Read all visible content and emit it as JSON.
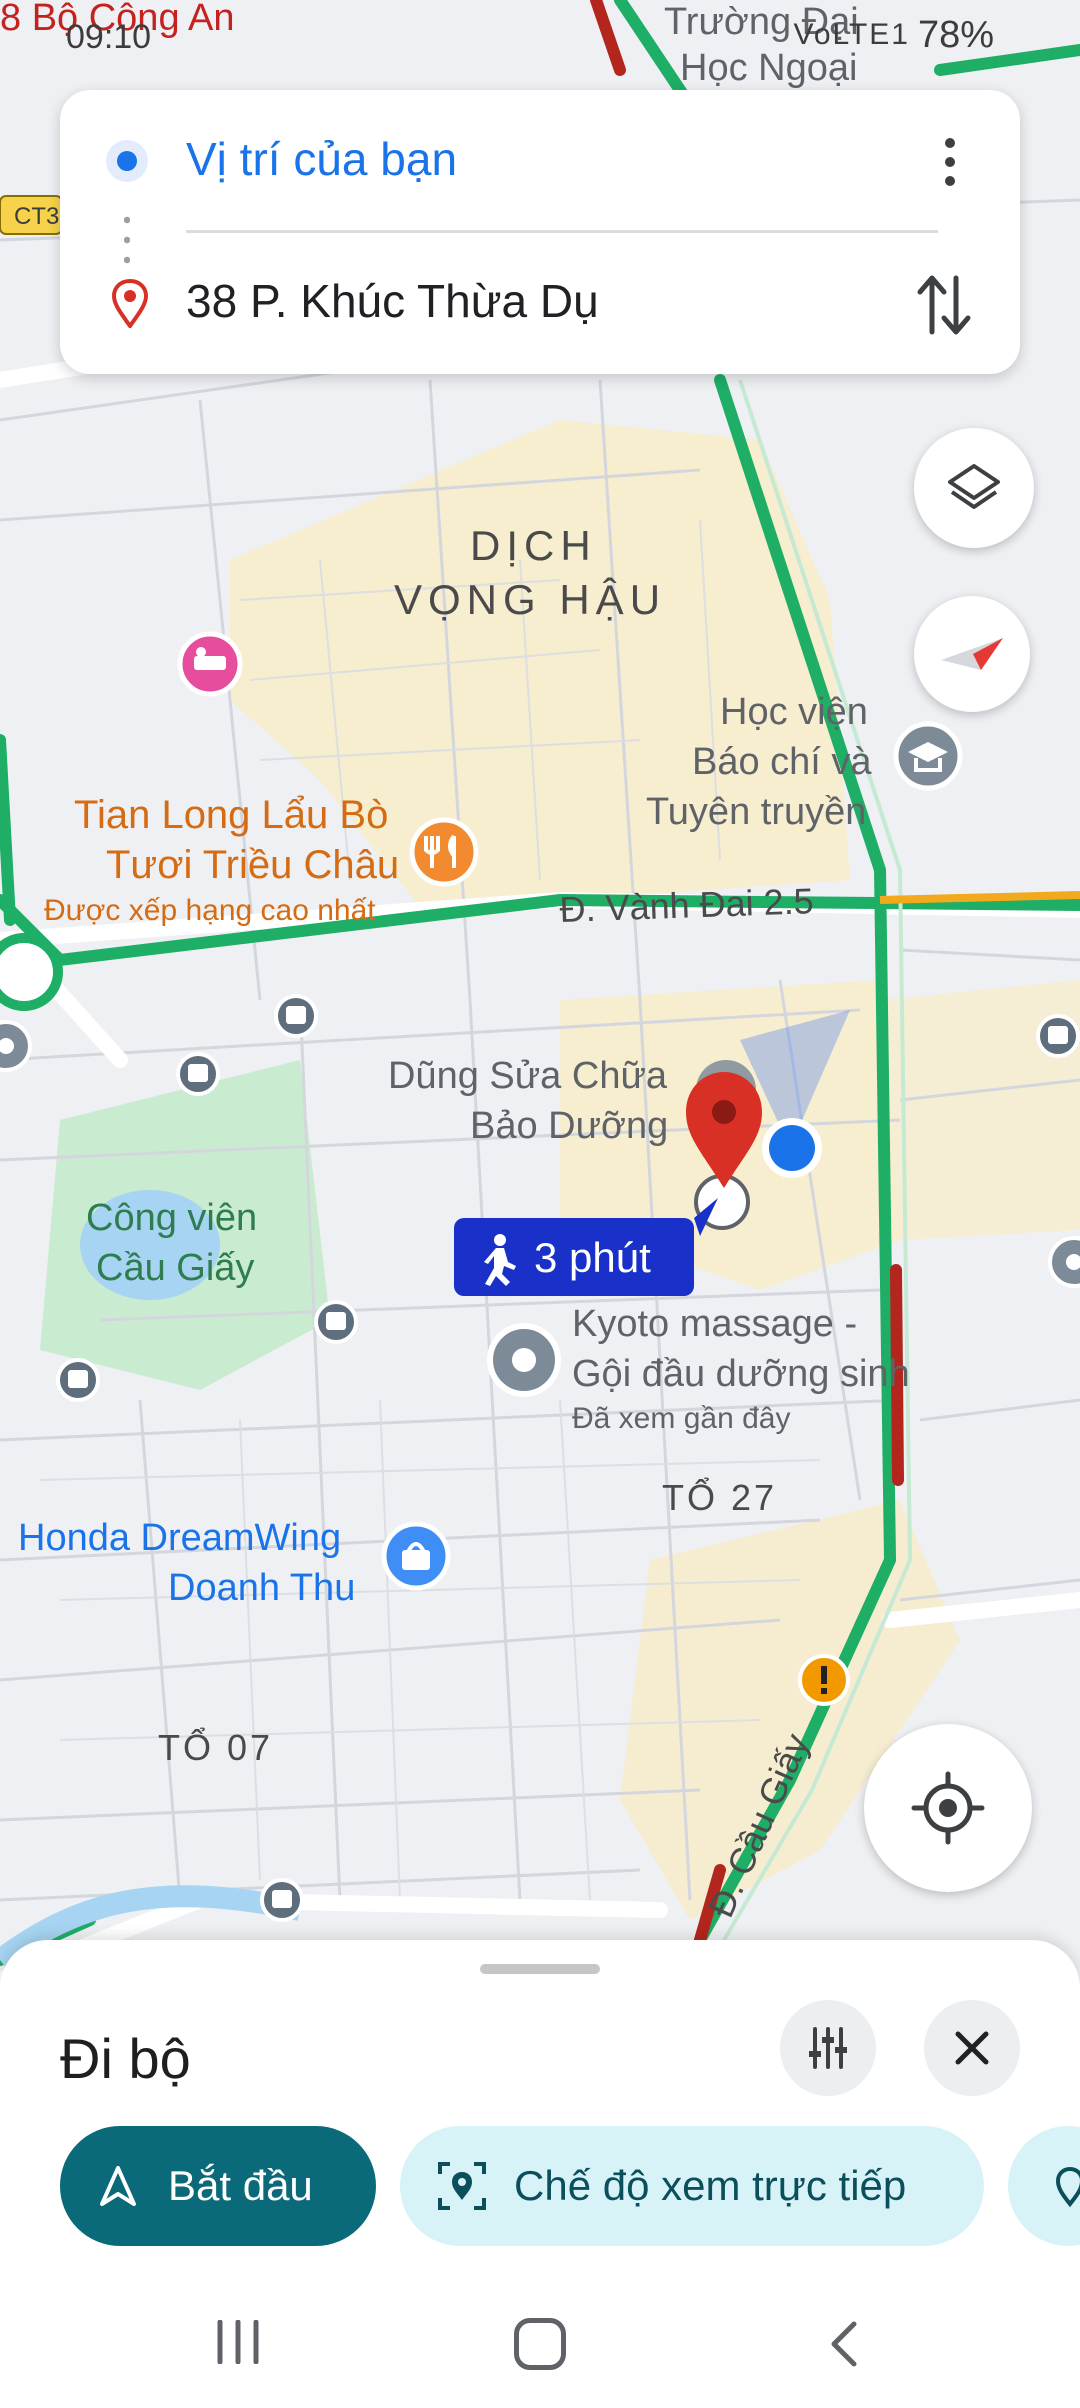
{
  "status_bar": {
    "time": "09:10",
    "signal": "VoLTE1",
    "battery": "78%"
  },
  "search": {
    "origin": "Vị trí của bạn",
    "destination": "38 P. Khúc Thừa Dụ"
  },
  "map": {
    "road_label_ct": "CT3",
    "area_top_left": "8 Bộ Công An",
    "area_top_right_1": "Trường Đại",
    "area_top_right_2": "Học Ngoại",
    "district_line1": "DỊCH",
    "district_line2": "VỌNG HẬU",
    "academy_line1": "Học viện",
    "academy_line2": "Báo chí và",
    "academy_line3": "Tuyên truyền",
    "restaurant_line1": "Tian Long Lẩu Bò",
    "restaurant_line2": "Tươi Triều Châu",
    "restaurant_badge": "Được xếp hạng cao nhất",
    "ring_road": "Đ. Vành Đai 2.5",
    "repair_line1": "Dũng Sửa Chữa",
    "repair_line2": "Bảo Dưỡng",
    "park_line1": "Công viên",
    "park_line2": "Cầu Giấy",
    "walk_time": "3 phút",
    "massage_line1": "Kyoto massage -",
    "massage_line2": "Gội đầu dưỡng sinh",
    "massage_note": "Đã xem gần đây",
    "to27": "TỔ 27",
    "honda_line1": "Honda DreamWing",
    "honda_line2": "Doanh Thu",
    "to07": "TỔ 07",
    "cau_giay_road": "Đ. Cầu Giấy"
  },
  "sheet": {
    "title": "Đi bộ",
    "start_label": "Bắt đầu",
    "live_view_label": "Chế độ xem trực tiếp"
  },
  "colors": {
    "accent_blue": "#1a73e8",
    "pin_red": "#d93025",
    "traffic_green": "#1eae66",
    "start_teal": "#0b6a7a",
    "walk_badge": "#1a31c9"
  },
  "icons": {
    "layers": "layers-icon",
    "compass": "compass-icon",
    "locate": "my-location-icon",
    "filter": "tune-icon",
    "close": "close-icon",
    "navigate": "navigation-arrow-icon",
    "live_view": "live-view-icon"
  }
}
